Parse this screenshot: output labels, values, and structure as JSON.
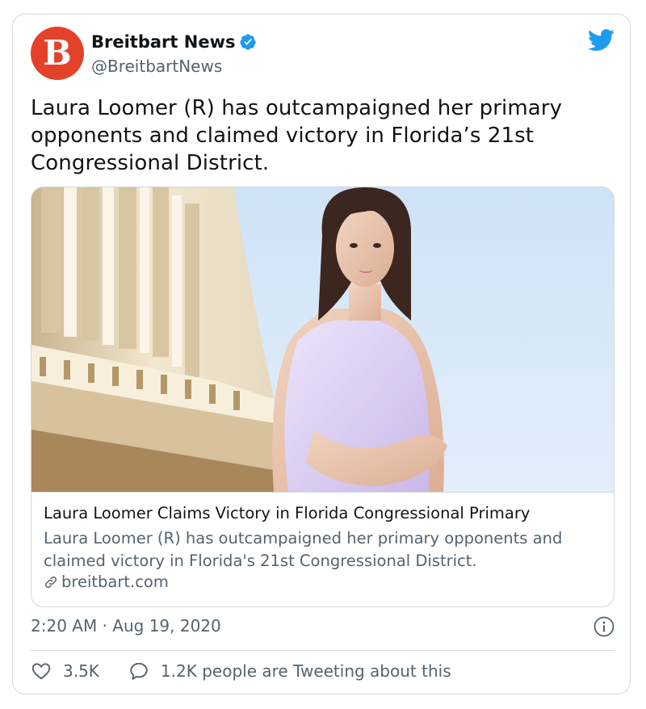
{
  "author": {
    "display_name": "Breitbart News",
    "handle": "@BreitbartNews",
    "avatar_letter": "B",
    "brand_color": "#e4412b"
  },
  "tweet": {
    "text": "Laura Loomer (R) has outcampaigned her primary opponents and claimed victory in Florida’s 21st Congressional District.",
    "timestamp": "2:20 AM · Aug 19, 2020"
  },
  "card": {
    "title": "Laura Loomer Claims Victory in Florida Congressional Primary",
    "description": "Laura Loomer (R) has outcampaigned her primary opponents and claimed victory in Florida's 21st Congressional District.",
    "domain": "breitbart.com"
  },
  "engagement": {
    "likes": "3.5K",
    "tweeting": "1.2K people are Tweeting about this"
  },
  "colors": {
    "twitter_blue": "#1d9bf0",
    "secondary_text": "#536471",
    "border": "#cfd9de"
  },
  "icons": [
    "breitbart-logo",
    "verified-badge-icon",
    "twitter-bird-icon",
    "link-icon",
    "info-icon",
    "heart-icon",
    "speech-bubble-icon"
  ]
}
